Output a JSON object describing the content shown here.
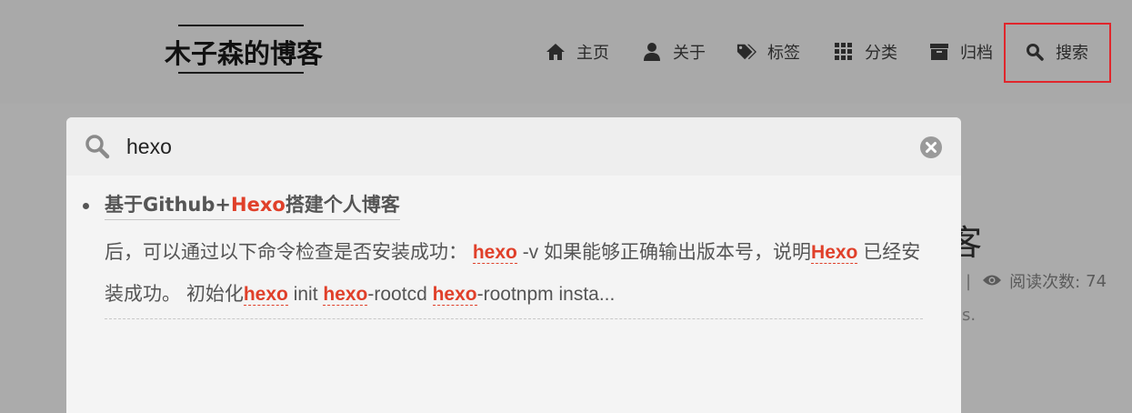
{
  "site": {
    "logo": "木子森的博客"
  },
  "nav": {
    "items": [
      {
        "label": "主页",
        "icon": "home-icon"
      },
      {
        "label": "关于",
        "icon": "user-icon"
      },
      {
        "label": "标签",
        "icon": "tags-icon"
      },
      {
        "label": "分类",
        "icon": "grid-icon"
      },
      {
        "label": "归档",
        "icon": "archive-icon"
      },
      {
        "label": "搜索",
        "icon": "search-icon"
      }
    ]
  },
  "background": {
    "title_fragment": "客",
    "meta_separator": "|",
    "read_label": "阅读次数:",
    "read_count": "74",
    "extra_fragment": "s."
  },
  "search": {
    "query": "hexo",
    "results": [
      {
        "title_prefix": "基于Github+",
        "title_keyword": "Hexo",
        "title_suffix": "搭建个人博客",
        "snippet": [
          {
            "t": "后，可以通过以下命令检查是否安装成功： ",
            "k": false
          },
          {
            "t": "hexo",
            "k": true
          },
          {
            "t": " -v 如果能够正确输出版本号，说明",
            "k": false
          },
          {
            "t": "Hexo",
            "k": true
          },
          {
            "t": " 已经安装成功。 初始化",
            "k": false
          },
          {
            "t": "hexo",
            "k": true
          },
          {
            "t": " init ",
            "k": false
          },
          {
            "t": "hexo",
            "k": true
          },
          {
            "t": "-rootcd ",
            "k": false
          },
          {
            "t": "hexo",
            "k": true
          },
          {
            "t": "-rootnpm insta...",
            "k": false
          }
        ]
      }
    ]
  },
  "colors": {
    "keyword": "#e0402a",
    "highlight_box": "#e0262c",
    "overlay": "#ababab"
  }
}
